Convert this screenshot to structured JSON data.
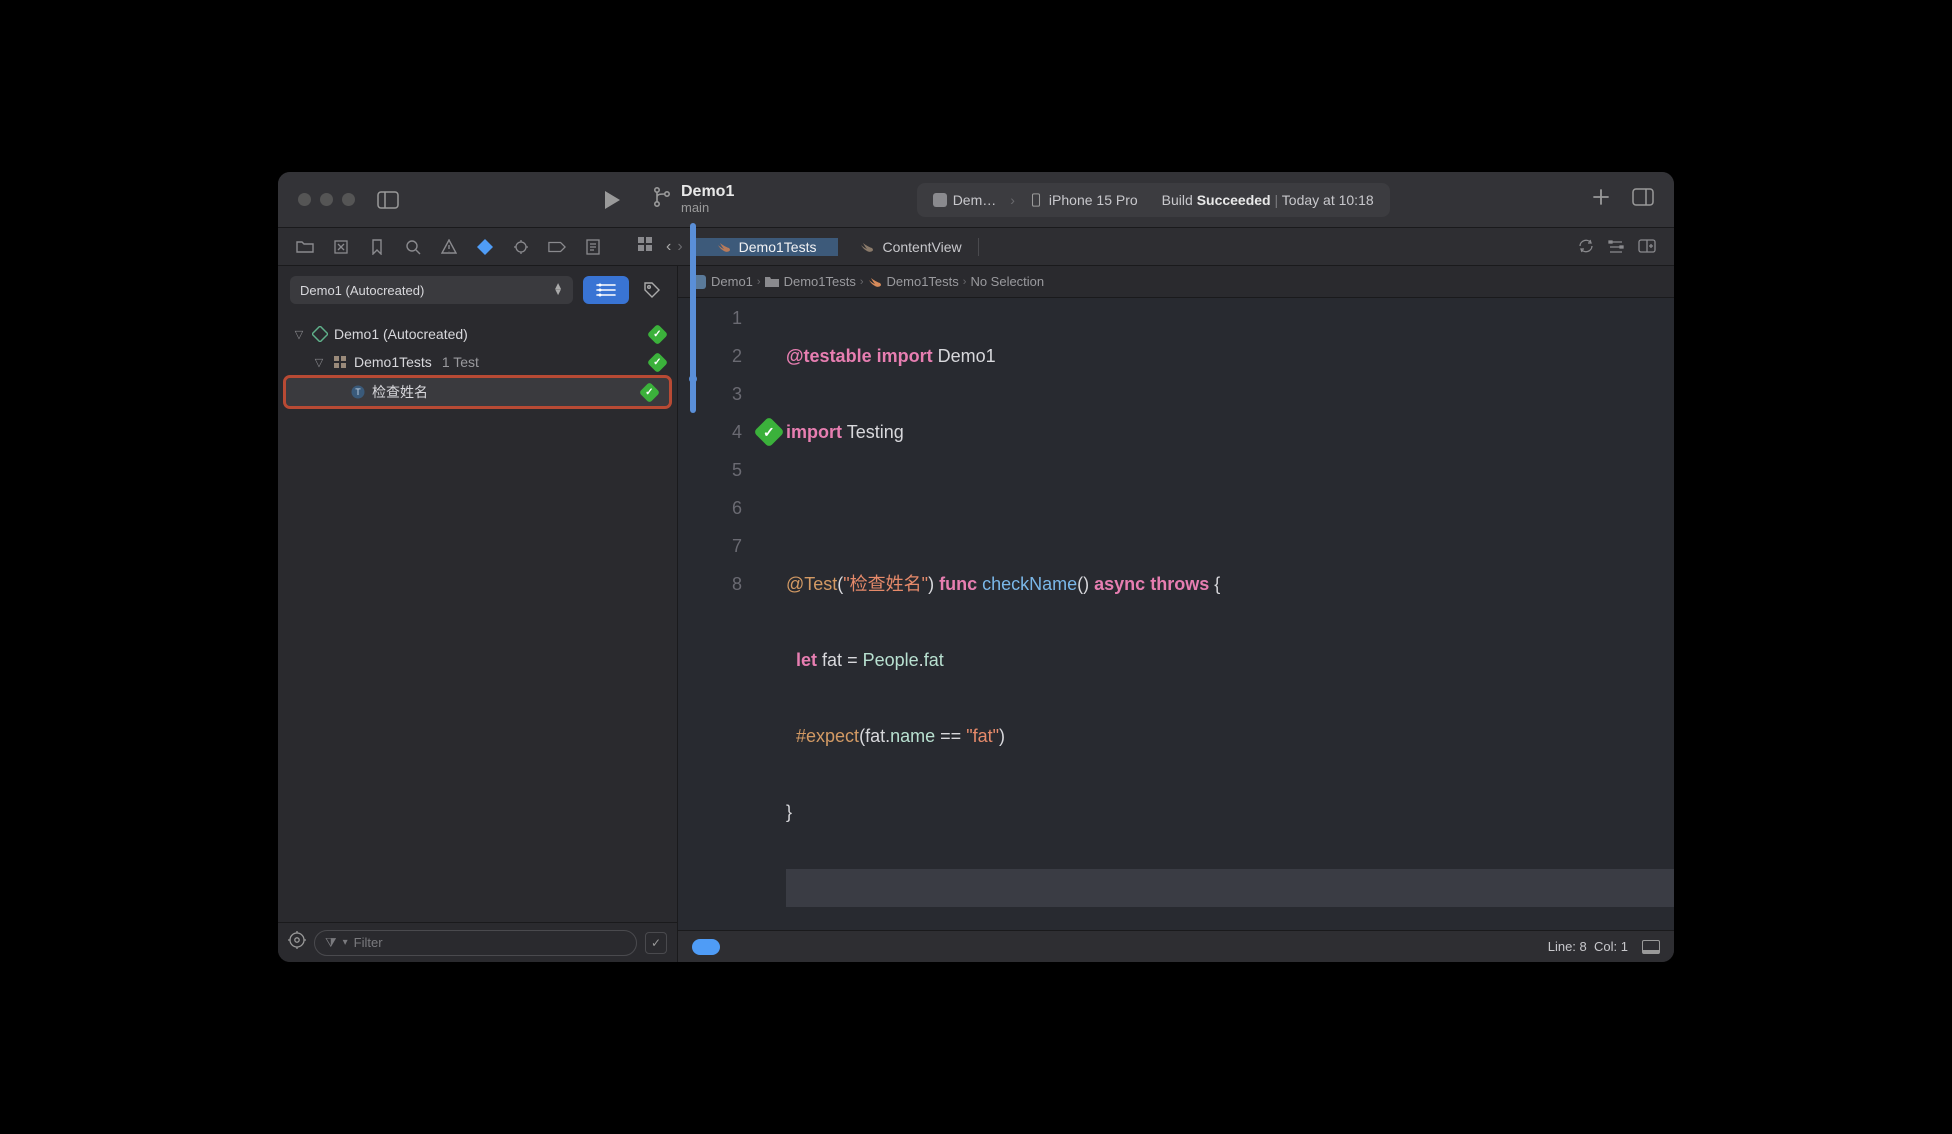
{
  "title": {
    "project": "Demo1",
    "branch": "main"
  },
  "target_well": {
    "scheme": "Dem…",
    "device": "iPhone 15 Pro",
    "build_prefix": "Build ",
    "build_result": "Succeeded",
    "build_time": "Today at 10:18"
  },
  "tabs": {
    "active": "Demo1Tests",
    "inactive": "ContentView"
  },
  "scheme_picker": "Demo1 (Autocreated)",
  "tree": {
    "plan": "Demo1 (Autocreated)",
    "suite": "Demo1Tests",
    "suite_count": "1 Test",
    "test": "检查姓名"
  },
  "sidebar_filter_placeholder": "Filter",
  "breadcrumb": {
    "c1": "Demo1",
    "c2": "Demo1Tests",
    "c3": "Demo1Tests",
    "c4": "No Selection"
  },
  "code": {
    "l1_a": "@testable",
    "l1_b": "import",
    "l1_c": "Demo1",
    "l2_a": "import",
    "l2_b": "Testing",
    "l4_attr": "@Test",
    "l4_str": "\"检查姓名\"",
    "l4_func": "func",
    "l4_name": "checkName",
    "l4_async": "async",
    "l4_throws": "throws",
    "l5_let": "let",
    "l5_var": "fat",
    "l5_type": "People",
    "l5_prop": "fat",
    "l6_macro": "#expect",
    "l6_a": "fat",
    "l6_b": "name",
    "l6_str": "\"fat\"",
    "l7": "}"
  },
  "linenums": [
    "1",
    "2",
    "3",
    "4",
    "5",
    "6",
    "7",
    "8"
  ],
  "footer": {
    "line_label": "Line:",
    "line": "8",
    "col_label": "Col:",
    "col": "1"
  }
}
